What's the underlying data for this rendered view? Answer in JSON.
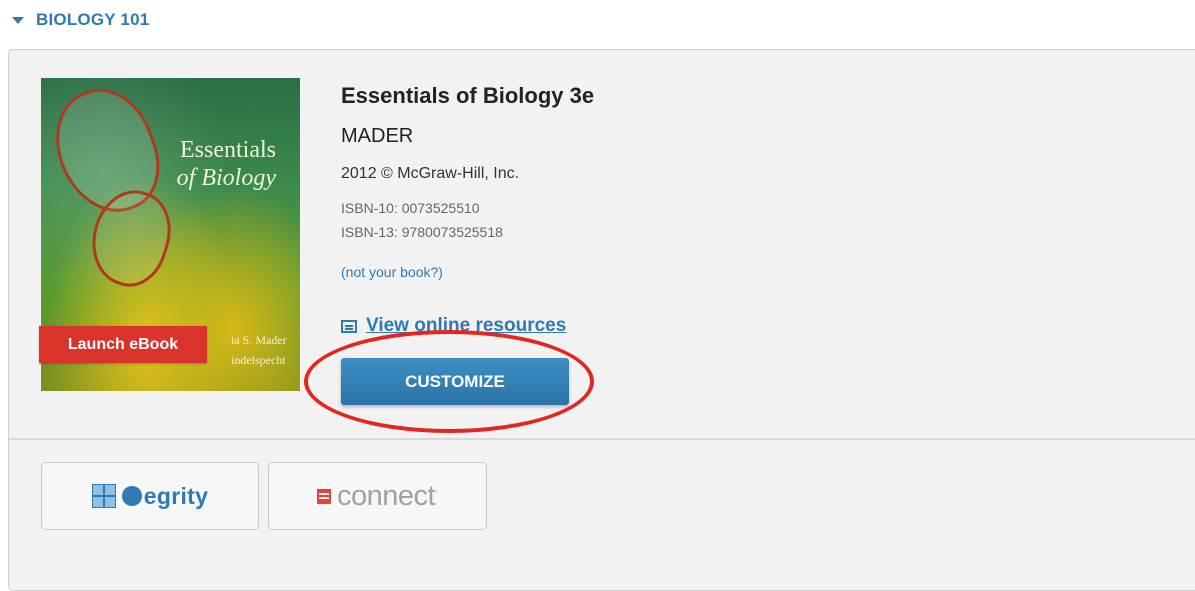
{
  "course": {
    "title": "BIOLOGY 101"
  },
  "book": {
    "title": "Essentials of Biology 3e",
    "author": "MADER",
    "copyright": "2012 © McGraw-Hill, Inc.",
    "isbn10": "ISBN-10: 0073525510",
    "isbn13": "ISBN-13: 9780073525518",
    "not_your_book": "(not your book?)",
    "cover": {
      "title_line1": "Essentials",
      "title_line2": "of Biology",
      "author_line1": "ia S. Mader",
      "author_line2": "indelspecht"
    }
  },
  "actions": {
    "launch_ebook": "Launch eBook",
    "view_online_resources": "View online resources",
    "customize": "CUSTOMIZE"
  },
  "tools": [
    {
      "label": "egrity",
      "icon": "tegrity-logo-icon"
    },
    {
      "label": "connect",
      "icon": "connect-logo-icon"
    }
  ],
  "colors": {
    "accent": "#2f79b5",
    "launch": "#d9332b",
    "highlight": "#e3261f"
  }
}
